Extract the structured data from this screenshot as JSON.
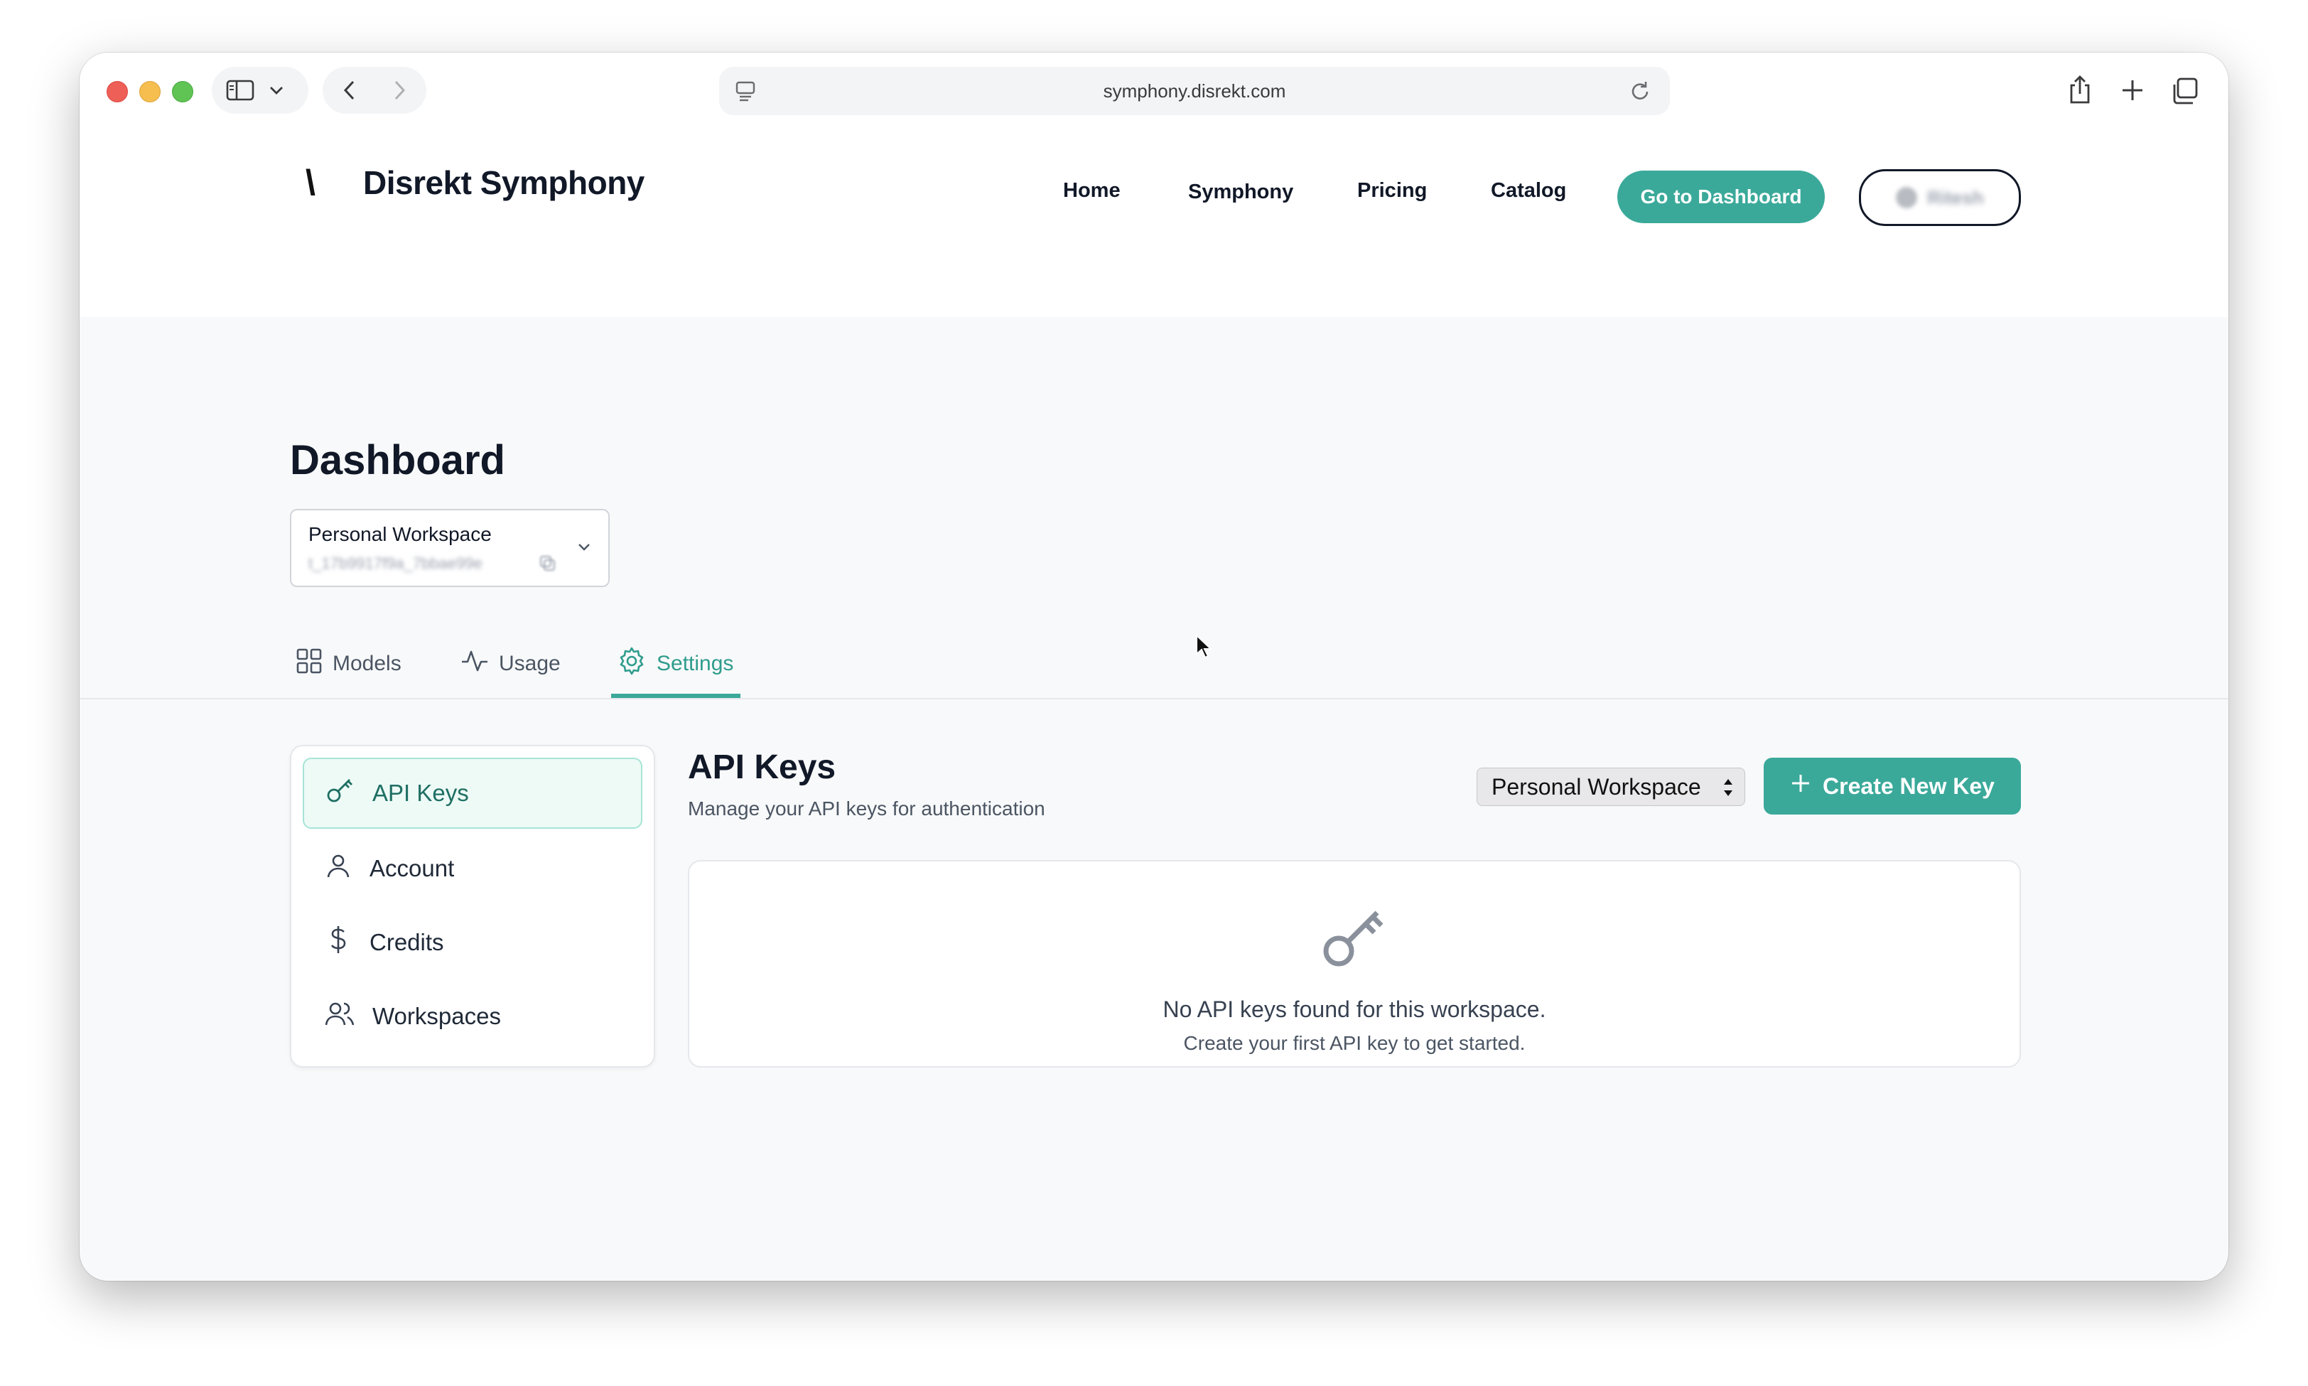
{
  "browser": {
    "url": "symphony.disrekt.com"
  },
  "site": {
    "logo_mark": "\\",
    "logo_text": "Disrekt Symphony",
    "nav": [
      "Home",
      "Symphony",
      "Pricing",
      "Catalog"
    ],
    "dashboard_button": "Go to Dashboard",
    "user_name": "Ritesh"
  },
  "dashboard": {
    "title": "Dashboard",
    "workspace_select": {
      "name": "Personal Workspace",
      "id": "t_17b9917f9a_7bbae99e"
    },
    "tabs": [
      {
        "label": "Models",
        "icon": "grid-icon"
      },
      {
        "label": "Usage",
        "icon": "activity-icon"
      },
      {
        "label": "Settings",
        "icon": "gear-icon",
        "active": true
      }
    ]
  },
  "settings": {
    "sidebar": [
      {
        "label": "API Keys",
        "icon": "key-icon",
        "active": true
      },
      {
        "label": "Account",
        "icon": "user-icon"
      },
      {
        "label": "Credits",
        "icon": "dollar-icon"
      },
      {
        "label": "Workspaces",
        "icon": "users-icon"
      }
    ],
    "panel": {
      "title": "API Keys",
      "subtitle": "Manage your API keys for authentication",
      "workspace_dropdown": "Personal Workspace",
      "create_button": "Create New Key",
      "empty_title": "No API keys found for this workspace.",
      "empty_subtitle": "Create your first API key to get started."
    }
  },
  "colors": {
    "accent": "#3aa99a",
    "accent_light": "#edfaf6",
    "page_bg": "#f8f9fa"
  }
}
